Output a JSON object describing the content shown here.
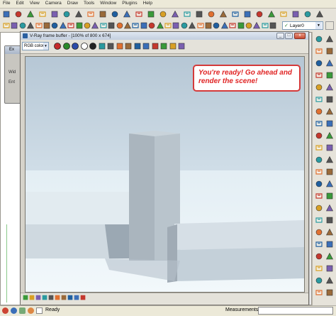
{
  "menu": [
    "File",
    "Edit",
    "View",
    "Camera",
    "Draw",
    "Tools",
    "Window",
    "Plugins",
    "Help"
  ],
  "layer_select": {
    "value": "Layer0"
  },
  "vray_window": {
    "title": "V-Ray frame buffer - [100% of 800 x 674]",
    "channel_select": "RGB color",
    "minimize": "_",
    "maximize": "□",
    "close": "x"
  },
  "callout": {
    "line1": "You're ready! Go ahead and",
    "line2": "render the scene!"
  },
  "left_panel": {
    "label_a": "Ex",
    "label_b": "Wid",
    "label_c": "Ent"
  },
  "statusbar": {
    "status": "Ready",
    "measurements_label": "Measurements"
  },
  "colors": {
    "callout_border": "#d43a3a",
    "callout_text": "#e02424",
    "sky_top": "#bccbd8",
    "ground": "#e8f1f5"
  },
  "icons": {
    "top_toolbar": [
      "new-icon",
      "open-icon",
      "save-icon",
      "cut-icon",
      "copy-icon",
      "paste-icon",
      "erase-icon",
      "undo-icon",
      "redo-icon",
      "print-icon",
      "model-info-icon",
      "iso-view-icon",
      "top-view-icon",
      "front-view-icon",
      "right-view-icon",
      "back-view-icon",
      "left-view-icon",
      "xray-icon",
      "wireframe-icon",
      "hidden-line-icon",
      "shaded-icon",
      "textured-icon",
      "monochrome-icon",
      "house-icon",
      "warehouse-icon",
      "components-icon",
      "extension-icon"
    ],
    "second_toolbar": [
      "select-icon",
      "component-icon",
      "paint-icon",
      "eraser-icon",
      "rectangle-icon",
      "line-icon",
      "circle-icon",
      "arc-icon",
      "polygon-icon",
      "freehand-icon",
      "move-icon",
      "pushpull-icon",
      "rotate-icon",
      "followme-icon",
      "scale-icon",
      "offset-icon",
      "tape-icon",
      "dimension-icon",
      "protractor-icon",
      "text-icon",
      "axes-icon",
      "3dtext-icon",
      "orbit-icon",
      "pan-icon",
      "zoom-icon",
      "zoom-window-icon",
      "zoom-extents-icon",
      "previous-icon",
      "next-icon",
      "position-camera-icon",
      "walk-icon",
      "look-around-icon",
      "section-icon",
      "layers-icon"
    ],
    "vray_toolbar": [
      "red-channel-icon",
      "green-channel-icon",
      "blue-channel-icon",
      "alpha-channel-icon",
      "monochrome-icon",
      "save-image-icon",
      "load-image-icon",
      "clear-icon",
      "duplicate-icon",
      "render-region-icon",
      "track-mouse-icon",
      "render-last-icon",
      "lens-effects-icon",
      "color-correction-icon",
      "levels-icon"
    ]
  }
}
